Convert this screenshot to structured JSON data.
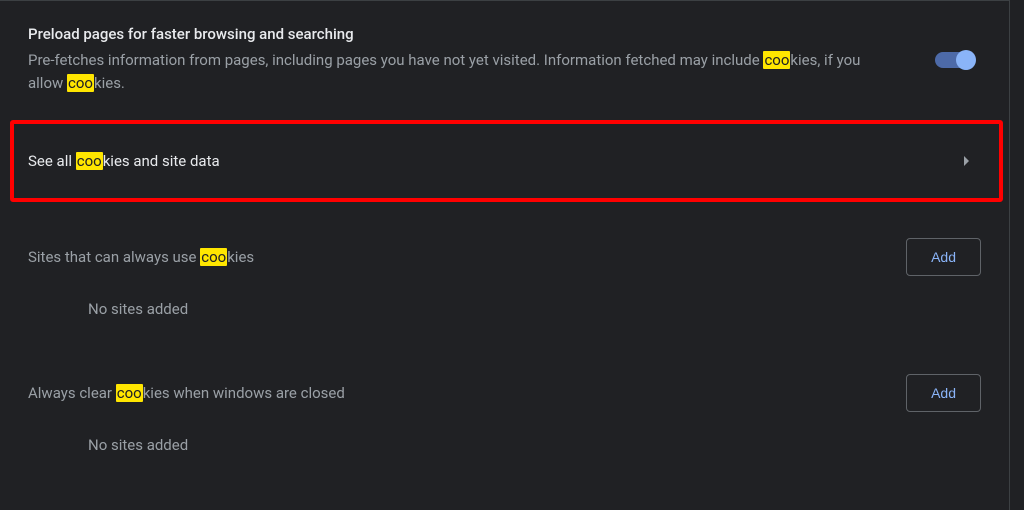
{
  "preload": {
    "title": "Preload pages for faster browsing and searching",
    "desc_pre": "Pre-fetches information from pages, including pages you have not yet visited. Information fetched may include ",
    "desc_h1": "coo",
    "desc_mid1": "kies, if you allow ",
    "desc_h2": "coo",
    "desc_post": "kies."
  },
  "see_all": {
    "pre": "See all ",
    "h": "coo",
    "post": "kies and site data"
  },
  "section1": {
    "pre": "Sites that can always use ",
    "h": "coo",
    "post": "kies",
    "add": "Add",
    "empty": "No sites added"
  },
  "section2": {
    "pre": "Always clear ",
    "h": "coo",
    "post": "kies when windows are closed",
    "add": "Add",
    "empty": "No sites added"
  }
}
